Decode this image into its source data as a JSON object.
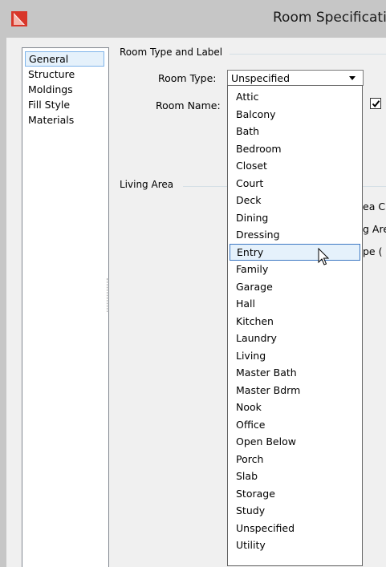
{
  "window": {
    "title": "Room Specification"
  },
  "nav": {
    "items": [
      {
        "label": "General",
        "selected": true
      },
      {
        "label": "Structure",
        "selected": false
      },
      {
        "label": "Moldings",
        "selected": false
      },
      {
        "label": "Fill Style",
        "selected": false
      },
      {
        "label": "Materials",
        "selected": false
      }
    ]
  },
  "room_type_group": {
    "heading": "Room Type and Label",
    "room_type_label": "Room Type:",
    "room_type_value": "Unspecified",
    "room_name_label": "Room Name:",
    "checkbox_checked": true
  },
  "living_area": {
    "heading": "Living Area",
    "partial_labels": [
      "ea C",
      "g Are",
      "pe ("
    ]
  },
  "dropdown": {
    "options": [
      "Attic",
      "Balcony",
      "Bath",
      "Bedroom",
      "Closet",
      "Court",
      "Deck",
      "Dining",
      "Dressing",
      "Entry",
      "Family",
      "Garage",
      "Hall",
      "Kitchen",
      "Laundry",
      "Living",
      "Master Bath",
      "Master Bdrm",
      "Nook",
      "Office",
      "Open Below",
      "Porch",
      "Slab",
      "Storage",
      "Study",
      "Unspecified",
      "Utility"
    ],
    "highlighted": "Entry"
  },
  "colors": {
    "titlebar": "#c6c6c6",
    "highlight_border": "#3c78c3",
    "highlight_fill": "#e5f1fb",
    "icon_red": "#d8362a"
  }
}
